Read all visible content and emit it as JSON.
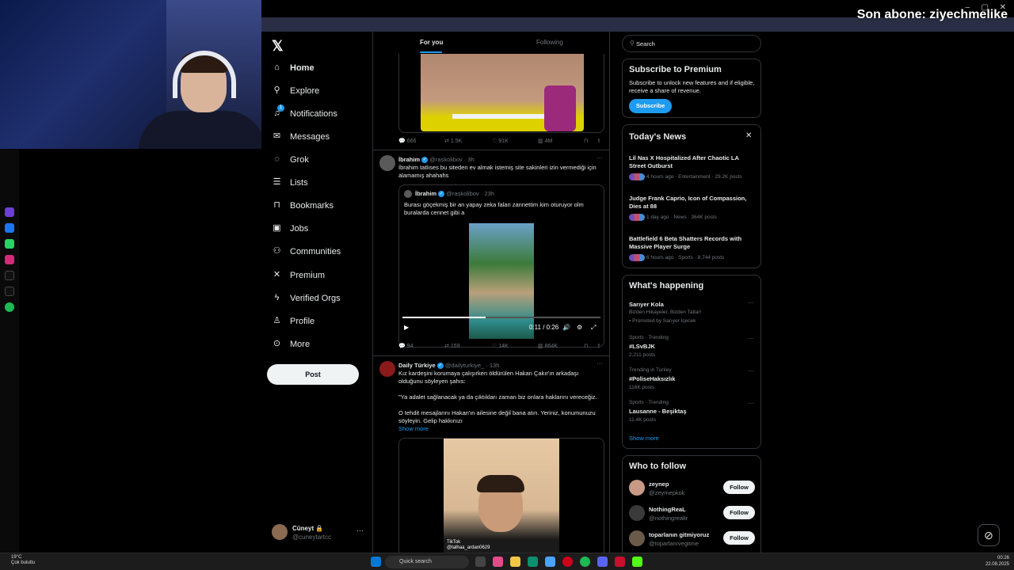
{
  "stream_overlay": {
    "text": "Son abone: ziyechmelike"
  },
  "nav": {
    "items": [
      {
        "label": "Home",
        "icon": "home-icon",
        "glyph": "⌂"
      },
      {
        "label": "Explore",
        "icon": "search-icon",
        "glyph": "⚲"
      },
      {
        "label": "Notifications",
        "icon": "bell-icon",
        "glyph": "♫"
      },
      {
        "label": "Messages",
        "icon": "mail-icon",
        "glyph": "✉"
      },
      {
        "label": "Grok",
        "icon": "grok-icon",
        "glyph": "◌"
      },
      {
        "label": "Lists",
        "icon": "list-icon",
        "glyph": "☰"
      },
      {
        "label": "Bookmarks",
        "icon": "bookmark-icon",
        "glyph": "⊓"
      },
      {
        "label": "Jobs",
        "icon": "briefcase-icon",
        "glyph": "▣"
      },
      {
        "label": "Communities",
        "icon": "people-icon",
        "glyph": "⚇"
      },
      {
        "label": "Premium",
        "icon": "x-logo-icon",
        "glyph": "✕"
      },
      {
        "label": "Verified Orgs",
        "icon": "lightning-icon",
        "glyph": "ϟ"
      },
      {
        "label": "Profile",
        "icon": "person-icon",
        "glyph": "♙"
      },
      {
        "label": "More",
        "icon": "more-circle-icon",
        "glyph": "⊙"
      }
    ],
    "post_label": "Post",
    "notifications_badge": "1"
  },
  "account": {
    "name": "Cüneyt 🔒",
    "handle": "@cuneytartcc"
  },
  "tabs": {
    "for_you": "For you",
    "following": "Following"
  },
  "posts": [
    {
      "actions": {
        "replies": "666",
        "reposts": "1.5K",
        "likes": "91K",
        "views": "4M"
      }
    },
    {
      "author": "İbrahim",
      "handle": "@raskolibov",
      "time": "· 3h",
      "text": "İbrahim tatlıses bu siteden ev almak istemiş site sakinleri izin vermediği için alamamış ahahahs",
      "quote": {
        "author": "İbrahim",
        "handle": "@raskolibov",
        "time": "· 23h",
        "text": "Burası göçekmiş bir an yapay zeka falan zannettim kim oturuyor olm buralarda cennet gibi a",
        "video_time": "0:11 / 0:26",
        "progress": 0.42
      },
      "actions": {
        "replies": "94",
        "reposts": "159",
        "likes": "14K",
        "views": "864K"
      }
    },
    {
      "author": "Daily Türkiye",
      "handle": "@dailyturkiye_",
      "time": "· 13h",
      "text1": "Kız kardeşini korumaya çalışırken öldürülen Hakan Çakır'ın arkadaşı olduğunu söyleyen şahıs:",
      "text2": "\"Ya adalet sağlanacak ya da çıktıkları zaman biz onlara haklarını vereceğiz.",
      "text3": "O tehdit mesajlarını Hakan'ın ailesine değil bana atın. Yeriniz, konumunuzu söyleyin. Gelip hakkınızı",
      "show_more": "Show more",
      "watermark": "TikTok",
      "watermark_handle": "@talhaa_ardan0629"
    }
  ],
  "search": {
    "placeholder": "Search"
  },
  "premium": {
    "title": "Subscribe to Premium",
    "text": "Subscribe to unlock new features and if eligible, receive a share of revenue.",
    "button": "Subscribe"
  },
  "news": {
    "title": "Today's News",
    "items": [
      {
        "title": "Lil Nas X Hospitalized After Chaotic LA Street Outburst",
        "meta": "4 hours ago · Entertainment · 29.2K posts"
      },
      {
        "title": "Judge Frank Caprio, Icon of Compassion, Dies at 88",
        "meta": "1 day ago · News · 364K posts"
      },
      {
        "title": "Battlefield 6 Beta Shatters Records with Massive Player Surge",
        "meta": "6 hours ago · Sports · 8,744 posts"
      }
    ]
  },
  "happening": {
    "title": "What's happening",
    "items": [
      {
        "category": "",
        "name": "Sarıyer Kola",
        "sub": "Bizden Hikayeler, Bizden Tatlar!",
        "promo": "Promoted by Sarıyer İçecek"
      },
      {
        "category": "Sports · Trending",
        "name": "#LSvBJK",
        "sub": "2,211 posts"
      },
      {
        "category": "Trending in Turkey",
        "name": "#PoliseHaksızlık",
        "sub": "116K posts"
      },
      {
        "category": "Sports · Trending",
        "name": "Lausanne - Beşiktaş",
        "sub": "11.4K posts"
      }
    ],
    "show_more": "Show more"
  },
  "who_to_follow": {
    "title": "Who to follow",
    "button": "Follow",
    "items": [
      {
        "name": "zeynep",
        "handle": "@zeymepkok",
        "color": "#c89a86"
      },
      {
        "name": "NothingReaL",
        "handle": "@nothingrealtr",
        "color": "#3a3a3a"
      },
      {
        "name": "toparlanın gitmiyoruz",
        "handle": "@toparlanıvegitme",
        "color": "#6a5a4a"
      }
    ]
  },
  "taskbar": {
    "weather_temp": "19°C",
    "weather_text": "Çok bulutlu",
    "search": "Quick search",
    "time": "00:26",
    "date": "22.08.2025"
  },
  "colors": {
    "accent": "#1d9bf0",
    "background": "#000000",
    "border": "#2f3336"
  }
}
